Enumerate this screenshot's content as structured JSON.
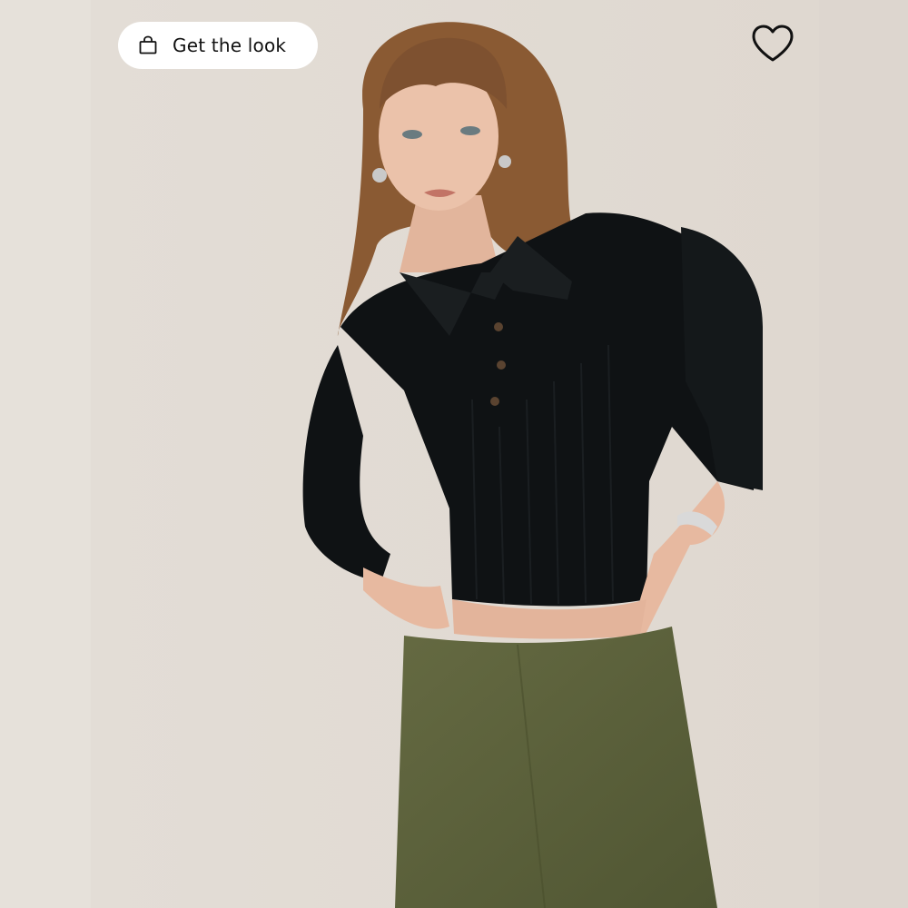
{
  "look_button": {
    "label": "Get the look",
    "icon": "shopping-bag-icon"
  },
  "favorite": {
    "icon": "heart-icon",
    "active": false
  },
  "colors": {
    "background": "#e2dbd4",
    "top": "#0f1214",
    "skirt": "#5b6039",
    "hair": "#8a5a33",
    "skin": "#e7b9a0"
  }
}
